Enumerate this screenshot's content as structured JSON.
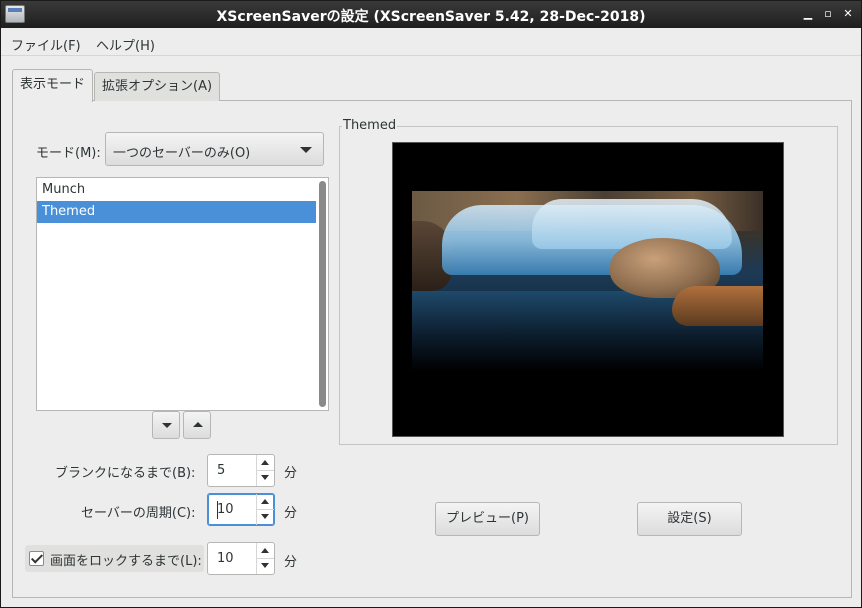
{
  "window": {
    "title": "XScreenSaverの設定 (XScreenSaver 5.42, 28-Dec-2018)",
    "minimize_glyph": "▁",
    "maximize_glyph": "▫",
    "close_glyph": "✕"
  },
  "menubar": {
    "file": "ファイル(F)",
    "help": "ヘルプ(H)"
  },
  "tabs": {
    "display_modes": "表示モード",
    "advanced": "拡張オプション(A)"
  },
  "mode": {
    "label": "モード(M):",
    "selected": "一つのセーバーのみ(O)"
  },
  "savers": [
    {
      "name": "Munch",
      "selected": false
    },
    {
      "name": "Themed",
      "selected": true
    }
  ],
  "timing": {
    "blank_after_label": "ブランクになるまで(B):",
    "blank_after_value": "5",
    "cycle_label": "セーバーの周期(C):",
    "cycle_value": "10",
    "lock_label": "画面をロックするまで(L):",
    "lock_value": "10",
    "lock_checked": true,
    "unit": "分"
  },
  "preview": {
    "frame_label": "Themed",
    "preview_button": "プレビュー(P)",
    "settings_button": "設定(S)"
  },
  "colors": {
    "selection": "#4a90d9",
    "titlebar": "#2a2a2a",
    "background": "#ededed"
  },
  "icons": [
    "app-window-icon",
    "minimize-icon",
    "maximize-icon",
    "close-icon",
    "chevron-down-icon",
    "arrow-down-icon",
    "arrow-up-icon",
    "checkmark-icon"
  ]
}
